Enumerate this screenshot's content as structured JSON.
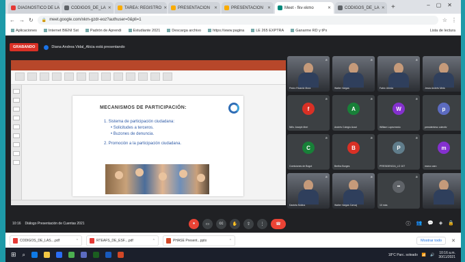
{
  "browser": {
    "tabs": [
      {
        "label": "DIAGNOSTICO DE LA",
        "color": "#e53935"
      },
      {
        "label": "CODIGOS_DE_LA",
        "color": "#5f6368"
      },
      {
        "label": "TAREA: REGISTRO",
        "color": "#f9ab00"
      },
      {
        "label": "PRESENTACION",
        "color": "#f9ab00"
      },
      {
        "label": "PRESENTACION",
        "color": "#f9ab00"
      },
      {
        "label": "Meet - fkv-xkmo",
        "color": "#00897b",
        "active": true
      },
      {
        "label": "CODIGOS_DE_LA",
        "color": "#5f6368"
      }
    ],
    "new_tab": "+",
    "url": "meet.google.com/xkm-gzdr-eoz?authuser=0&pli=1",
    "bookmarks": [
      "Aplicaciones",
      "Internet BIENI Sst",
      "Padrón de Aprendi",
      "Estudiante 2021",
      "Descarga archivo",
      "https://www.pagina",
      "LE 265 EXPTRA",
      "Ganarme RD y tPx"
    ],
    "bookmarks_right": "Lista de lectura"
  },
  "meet": {
    "recording_label": "GRABANDO",
    "recording_note": "Diana Andrea Vidal_Alicia está presentando",
    "slide": {
      "title": "MECANISMOS DE PARTICIPACIÓN:",
      "items": [
        {
          "text": "1.  Sistema de participación ciudadana:",
          "level": 0
        },
        {
          "text": "•  Solicitudes a terceros.",
          "level": 1
        },
        {
          "text": "•  Buzones de denuncia.",
          "level": 1
        },
        {
          "text": "2.  Promoción a la participación ciudadana.",
          "level": 0
        }
      ]
    },
    "participants": [
      {
        "name": "Pedro Ricardo Mora",
        "type": "video"
      },
      {
        "name": "Walter Vargas",
        "type": "video"
      },
      {
        "name": "Fabio Ubeda",
        "type": "video"
      },
      {
        "name": "Jesús Andrés Mela",
        "type": "video"
      },
      {
        "name": "Niño Joseph Meri",
        "initial": "f",
        "color": "#d93025"
      },
      {
        "name": "Andrés Colegio Acad",
        "initial": "A",
        "color": "#188038"
      },
      {
        "name": "William Lopezmedu",
        "initial": "W",
        "color": "#8430ce"
      },
      {
        "name": "presidentesc colectiv",
        "initial": "p",
        "color": "#5c6bc0"
      },
      {
        "name": "Comisiones de Bogot",
        "initial": "C",
        "color": "#188038"
      },
      {
        "name": "Bertha Borges",
        "initial": "B",
        "color": "#d93025"
      },
      {
        "name": "PRESIDENCIA_LO 107",
        "initial": "P",
        "color": "#607d8b"
      },
      {
        "name": "marco caro",
        "initial": "m",
        "color": "#8430ce"
      },
      {
        "name": "Daniela Molina",
        "type": "video"
      },
      {
        "name": "Walter Vargas Carvaj",
        "type": "video"
      },
      {
        "name": "10 más",
        "type": "more"
      },
      {
        "name": "",
        "type": "video"
      }
    ],
    "meeting_time": "10:16",
    "meeting_title": "Diálogo Presentación de Cuentas 2021"
  },
  "downloads": [
    {
      "name": "CODIGOS_DE_LAS....pdf",
      "kind": "pdf"
    },
    {
      "name": "RTEAFS_DE_ESF....pdf",
      "kind": "pdf"
    },
    {
      "name": "PHASE Present...pptx",
      "kind": "ppt"
    }
  ],
  "downloads_show_all": "Mostrar todo",
  "taskbar": {
    "weather": "18°C  Parc. soleado",
    "time": "10:16 a.m.",
    "date": "30/11/2021"
  }
}
